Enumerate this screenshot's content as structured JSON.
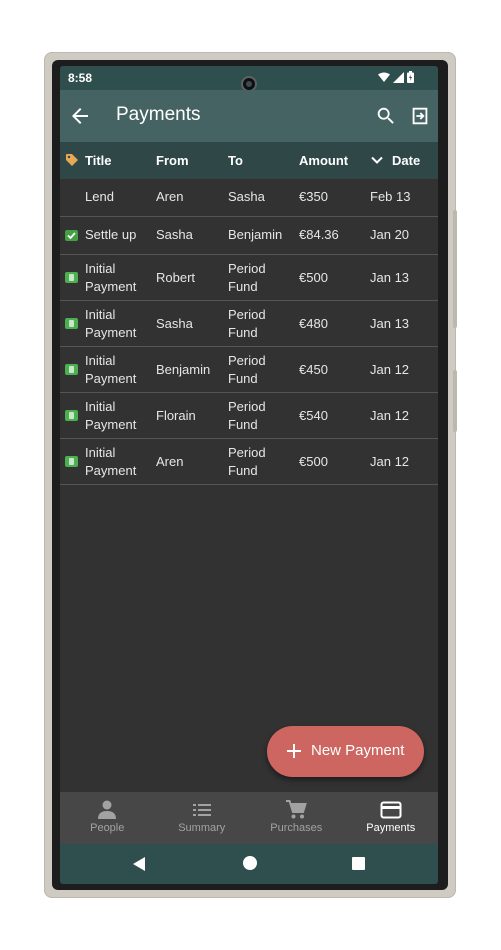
{
  "status_bar": {
    "time": "8:58"
  },
  "app_bar": {
    "title": "Payments"
  },
  "table": {
    "columns": {
      "title": "Title",
      "from": "From",
      "to": "To",
      "amount": "Amount",
      "date": "Date"
    },
    "rows": [
      {
        "icon": "none",
        "title": "Lend",
        "from": "Aren",
        "to": "Sasha",
        "amount": "€350",
        "date": "Feb 13"
      },
      {
        "icon": "check-icon",
        "title": "Settle up",
        "from": "Sasha",
        "to": "Benjamin",
        "amount": "€84.36",
        "date": "Jan 20"
      },
      {
        "icon": "cash-icon",
        "title": "Initial Payment",
        "from": "Robert",
        "to": "Period Fund",
        "amount": "€500",
        "date": "Jan 13"
      },
      {
        "icon": "cash-icon",
        "title": "Initial Payment",
        "from": "Sasha",
        "to": "Period Fund",
        "amount": "€480",
        "date": "Jan 13"
      },
      {
        "icon": "cash-icon",
        "title": "Initial Payment",
        "from": "Benjamin",
        "to": "Period Fund",
        "amount": "€450",
        "date": "Jan 12"
      },
      {
        "icon": "cash-icon",
        "title": "Initial Payment",
        "from": "Florain",
        "to": "Period Fund",
        "amount": "€540",
        "date": "Jan 12"
      },
      {
        "icon": "cash-icon",
        "title": "Initial Payment",
        "from": "Aren",
        "to": "Period Fund",
        "amount": "€500",
        "date": "Jan 12"
      }
    ]
  },
  "fab": {
    "label": "New Payment"
  },
  "bottom_nav": {
    "items": [
      {
        "label": "People",
        "icon": "person-icon",
        "active": false
      },
      {
        "label": "Summary",
        "icon": "list-icon",
        "active": false
      },
      {
        "label": "Purchases",
        "icon": "cart-icon",
        "active": false
      },
      {
        "label": "Payments",
        "icon": "card-icon",
        "active": true
      }
    ]
  },
  "colors": {
    "app_bar": "#466363",
    "status_bar": "#2f4f4f",
    "background": "#323232",
    "fab": "#cd6660",
    "bottom_nav": "#474747"
  }
}
